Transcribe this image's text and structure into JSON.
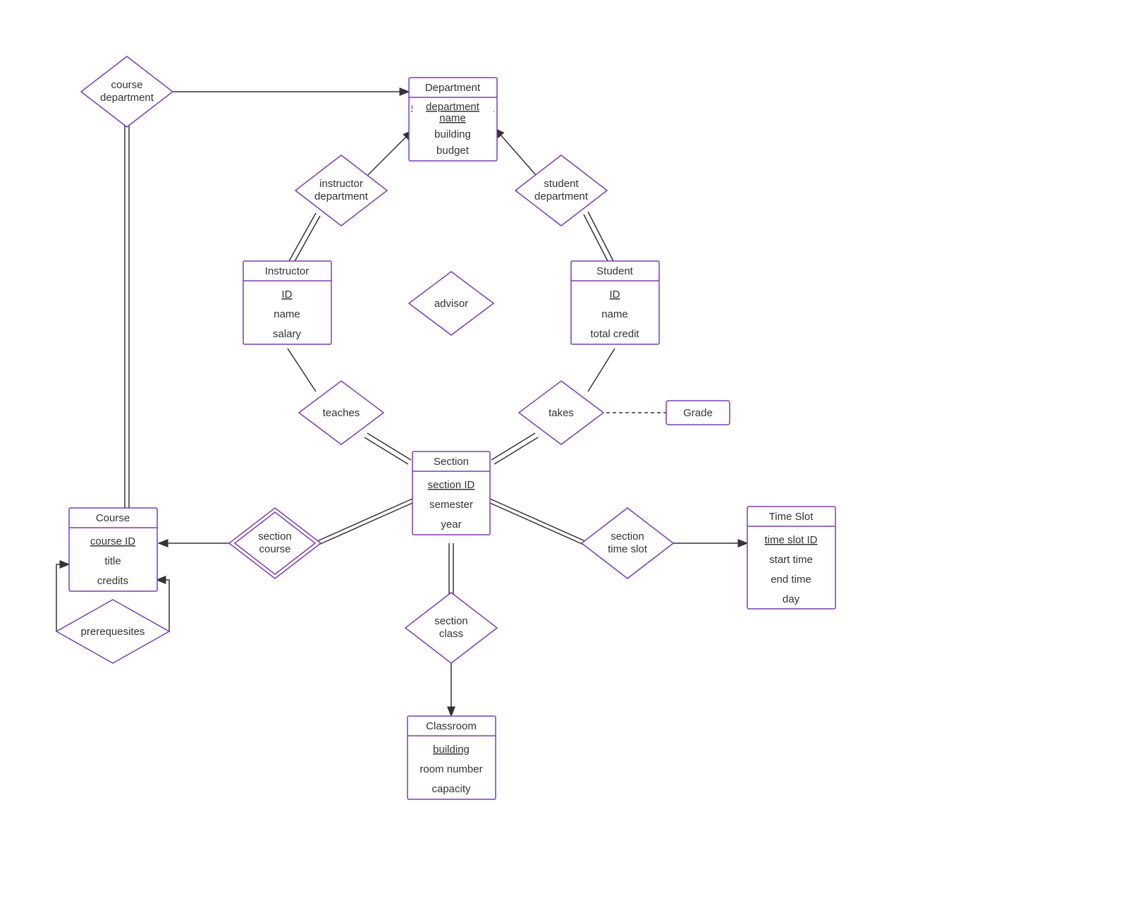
{
  "entities": {
    "department": {
      "title": "Department",
      "attrs": [
        "department name",
        "building",
        "budget"
      ],
      "key_index": 0
    },
    "instructor": {
      "title": "Instructor",
      "attrs": [
        "ID",
        "name",
        "salary"
      ],
      "key_index": 0
    },
    "student": {
      "title": "Student",
      "attrs": [
        "ID",
        "name",
        "total credit"
      ],
      "key_index": 0
    },
    "section": {
      "title": "Section",
      "attrs": [
        "section ID",
        "semester",
        "year"
      ],
      "key_index": 0
    },
    "course": {
      "title": "Course",
      "attrs": [
        "course ID",
        "title",
        "credits"
      ],
      "key_index": 0
    },
    "timeslot": {
      "title": "Time Slot",
      "attrs": [
        "time slot ID",
        "start time",
        "end time",
        "day"
      ],
      "key_index": 0
    },
    "classroom": {
      "title": "Classroom",
      "attrs": [
        "building",
        "room number",
        "capacity"
      ],
      "key_index": 0
    },
    "grade": {
      "title": "Grade",
      "attrs": [],
      "key_index": -1
    }
  },
  "relationships": {
    "course_department": {
      "l1": "course",
      "l2": "department"
    },
    "instructor_department": {
      "l1": "instructor",
      "l2": "department"
    },
    "student_department": {
      "l1": "student",
      "l2": "department"
    },
    "advisor": {
      "l1": "advisor"
    },
    "teaches": {
      "l1": "teaches"
    },
    "takes": {
      "l1": "takes"
    },
    "section_course": {
      "l1": "section",
      "l2": "course"
    },
    "section_timeslot": {
      "l1": "section",
      "l2": "time slot"
    },
    "section_class": {
      "l1": "section",
      "l2": "class"
    },
    "prerequesites": {
      "l1": "prerequesites"
    }
  }
}
